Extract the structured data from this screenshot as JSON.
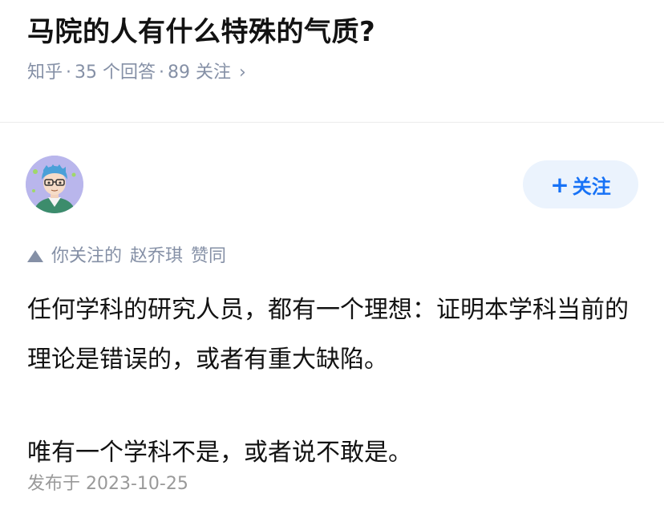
{
  "question": {
    "title": "马院的人有什么特殊的气质?",
    "source": "知乎",
    "answers_count": "35 个回答",
    "followers_count": "89 关注",
    "separator": "·",
    "chevron": "›"
  },
  "author": {
    "avatar_icon": "cartoon-avatar-icon",
    "follow_plus": "+",
    "follow_label": "关注"
  },
  "endorsement": {
    "icon": "triangle-up-icon",
    "prefix": "你关注的",
    "user": "赵乔琪",
    "action": "赞同"
  },
  "answer": {
    "paragraphs": [
      "任何学科的研究人员，都有一个理想：证明本学科当前的理论是错误的，或者有重大缺陷。",
      "唯有一个学科不是，或者说不敢是。"
    ],
    "published": "发布于 2023-10-25"
  },
  "colors": {
    "brand_blue": "#1772f6",
    "follow_bg": "#ebf3fd",
    "meta_gray": "#8590a6",
    "text": "#121212"
  }
}
